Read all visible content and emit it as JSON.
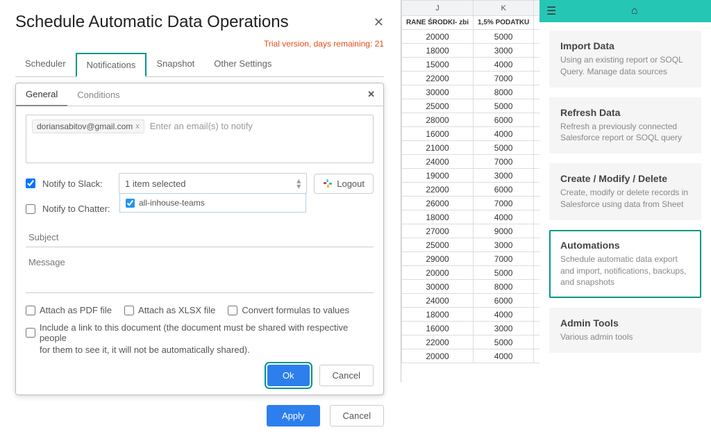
{
  "dialog": {
    "title": "Schedule Automatic Data Operations",
    "trial": "Trial version, days remaining: 21",
    "tabs": [
      "Scheduler",
      "Notifications",
      "Snapshot",
      "Other Settings"
    ],
    "inner_tabs": [
      "General",
      "Conditions"
    ],
    "email_chip": "doriansabitov@gmail.com",
    "email_placeholder": "Enter an email(s) to notify",
    "notify_slack": "Notify to Slack:",
    "notify_chatter": "Notify to Chatter:",
    "slack_selected": "1 item selected",
    "slack_option": "all-inhouse-teams",
    "logout": "Logout",
    "subject_placeholder": "Subject",
    "message_placeholder": "Message",
    "attach_pdf": "Attach as PDF file",
    "attach_xlsx": "Attach as XLSX file",
    "convert": "Convert formulas to values",
    "include_link": "Include a link to this document (the document must be shared with respective people",
    "include_link2": "for them to see it, it will not be automatically shared).",
    "ok": "Ok",
    "cancel": "Cancel",
    "apply": "Apply",
    "cancel2": "Cancel"
  },
  "sheet": {
    "cols": [
      "J",
      "K"
    ],
    "headers": [
      "RANE ŚRODKI- zbi",
      "1,5% PODATKU"
    ],
    "rows": [
      [
        "20000",
        "5000"
      ],
      [
        "18000",
        "3000"
      ],
      [
        "15000",
        "4000"
      ],
      [
        "22000",
        "7000"
      ],
      [
        "30000",
        "8000"
      ],
      [
        "25000",
        "5000"
      ],
      [
        "28000",
        "6000"
      ],
      [
        "16000",
        "4000"
      ],
      [
        "21000",
        "5000"
      ],
      [
        "24000",
        "7000"
      ],
      [
        "19000",
        "3000"
      ],
      [
        "22000",
        "6000"
      ],
      [
        "26000",
        "7000"
      ],
      [
        "18000",
        "4000"
      ],
      [
        "27000",
        "9000"
      ],
      [
        "25000",
        "3000"
      ],
      [
        "29000",
        "7000"
      ],
      [
        "20000",
        "5000"
      ],
      [
        "30000",
        "8000"
      ],
      [
        "24000",
        "6000"
      ],
      [
        "18000",
        "4000"
      ],
      [
        "16000",
        "3000"
      ],
      [
        "22000",
        "5000"
      ],
      [
        "20000",
        "4000"
      ]
    ]
  },
  "panel": {
    "cards": [
      {
        "title": "Import Data",
        "desc": "Using an existing report or SOQL Query. Manage data sources"
      },
      {
        "title": "Refresh Data",
        "desc": "Refresh a previously connected Salesforce report or SOQL query"
      },
      {
        "title": "Create / Modify / Delete",
        "desc": "Create, modify or delete records in Salesforce using data from Sheet"
      },
      {
        "title": "Automations",
        "desc": "Schedule automatic data export and import, notifications, backups, and snapshots"
      },
      {
        "title": "Admin Tools",
        "desc": "Various admin tools"
      }
    ]
  }
}
